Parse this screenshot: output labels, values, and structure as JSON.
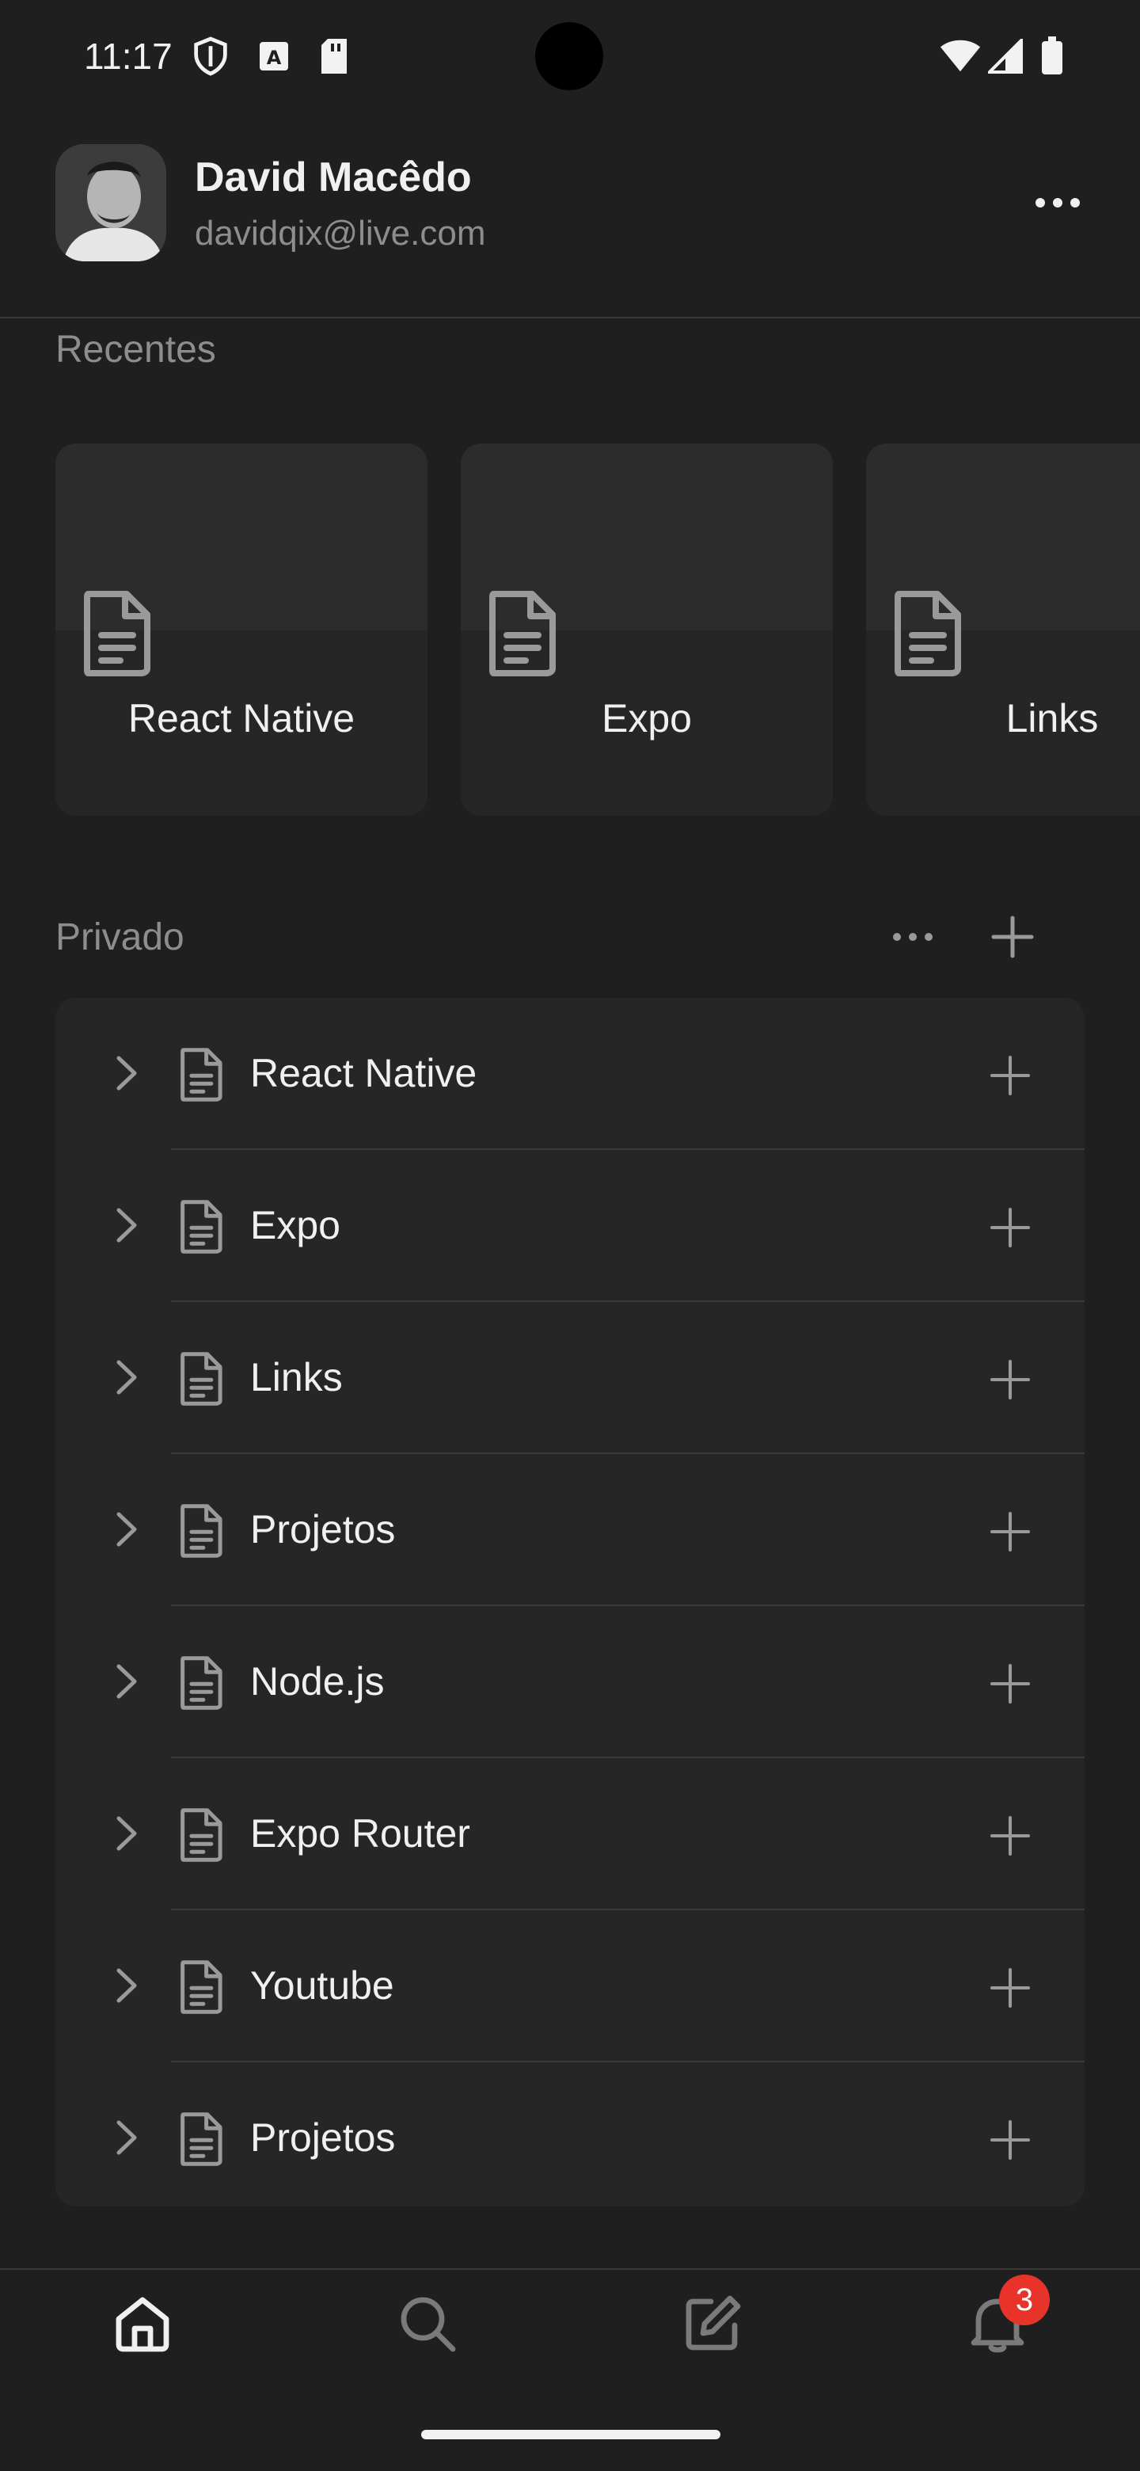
{
  "status_bar": {
    "time": "11:17",
    "left_icons": [
      "shield-icon",
      "font-a-icon",
      "sd-card-icon"
    ],
    "right_icons": [
      "wifi-icon",
      "signal-icon",
      "battery-icon"
    ]
  },
  "header": {
    "user_name": "David Macêdo",
    "user_email": "davidqix@live.com",
    "menu_icon": "more-horizontal-icon"
  },
  "recent": {
    "label": "Recentes",
    "cards": [
      {
        "title": "React Native",
        "icon": "document-icon"
      },
      {
        "title": "Expo",
        "icon": "document-icon"
      },
      {
        "title": "Links",
        "icon": "document-icon"
      }
    ]
  },
  "private": {
    "label": "Privado",
    "items": [
      {
        "label": "React Native"
      },
      {
        "label": "Expo"
      },
      {
        "label": "Links"
      },
      {
        "label": "Projetos"
      },
      {
        "label": "Node.js"
      },
      {
        "label": "Expo Router"
      },
      {
        "label": "Youtube"
      },
      {
        "label": "Projetos"
      }
    ]
  },
  "tab_bar": {
    "tabs": [
      {
        "name": "home",
        "icon": "home-icon",
        "active": true
      },
      {
        "name": "search",
        "icon": "search-icon",
        "active": false
      },
      {
        "name": "new",
        "icon": "edit-icon",
        "active": false
      },
      {
        "name": "notifications",
        "icon": "bell-icon",
        "active": false
      }
    ],
    "notification_badge": "3"
  },
  "colors": {
    "background": "#1f1f1f",
    "surface": "#262626",
    "text": "#f0f0f0",
    "muted_text": "#8d8d8d",
    "badge": "#e8332b"
  }
}
